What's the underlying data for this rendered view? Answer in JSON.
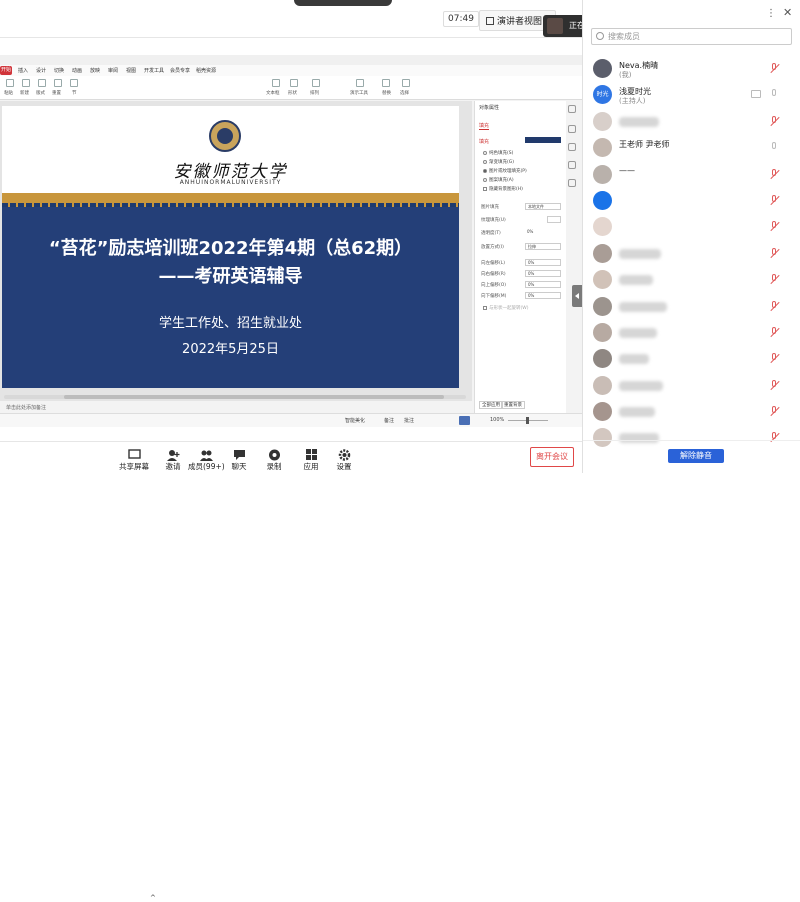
{
  "topbar": {
    "time": "07:49",
    "presenter_view": "演讲者视图",
    "speaking_label": "正在讲话:"
  },
  "participants_panel": {
    "search_placeholder": "搜索成员",
    "unmute_all": "解除静音",
    "members": [
      {
        "name": "Neva.楠晴",
        "sub": "(我)",
        "avatar_color": "#5b5e6b",
        "blur_width": 0,
        "mic": "muted"
      },
      {
        "name": "浅夏时光",
        "sub": "(主持人)",
        "avatar_color": "#2f76e4",
        "avatar_text": "时光",
        "blur_width": 0,
        "mic": "on",
        "camera": true
      },
      {
        "name": "",
        "sub": "",
        "avatar_color": "#d8cfca",
        "blur_width": 40,
        "mic": "muted"
      },
      {
        "name": "王老师 尹老师",
        "sub": "",
        "avatar_color": "#c4b8b0",
        "blur_width": 0,
        "mic": "on"
      },
      {
        "name": "——",
        "sub": "",
        "avatar_color": "#b9b1ab",
        "blur_width": 0,
        "mic": "muted"
      },
      {
        "name": "",
        "sub": "",
        "avatar_color": "#1a73e8",
        "blur_width": 0,
        "mic": "muted"
      },
      {
        "name": "",
        "sub": "",
        "avatar_color": "#e4d6cf",
        "blur_width": 0,
        "mic": "muted"
      },
      {
        "name": "",
        "sub": "",
        "avatar_color": "#a99d96",
        "blur_width": 42,
        "mic": "muted"
      },
      {
        "name": "",
        "sub": "",
        "avatar_color": "#d1c2b8",
        "blur_width": 34,
        "mic": "muted"
      },
      {
        "name": "",
        "sub": "",
        "avatar_color": "#9c948e",
        "blur_width": 48,
        "mic": "muted"
      },
      {
        "name": "",
        "sub": "",
        "avatar_color": "#b7aaa2",
        "blur_width": 38,
        "mic": "muted"
      },
      {
        "name": "",
        "sub": "",
        "avatar_color": "#8f8782",
        "blur_width": 30,
        "mic": "muted"
      },
      {
        "name": "",
        "sub": "",
        "avatar_color": "#c9bdb6",
        "blur_width": 44,
        "mic": "muted"
      },
      {
        "name": "",
        "sub": "",
        "avatar_color": "#a5958e",
        "blur_width": 36,
        "mic": "muted"
      },
      {
        "name": "",
        "sub": "",
        "avatar_color": "#d3c7c0",
        "blur_width": 40,
        "mic": "muted"
      }
    ]
  },
  "slide": {
    "university_cn": "安徽师范大学",
    "university_en": "ANHUINORMALUNIVERSITY",
    "title_line1": "“苔花”励志培训班2022年第4期（总62期）",
    "title_line2": "——考研英语辅导",
    "organizer": "学生工作处、招生就业处",
    "date": "2022年5月25日"
  },
  "wps": {
    "start_label": "开始",
    "menu": [
      "插入",
      "设计",
      "切换",
      "动画",
      "放映",
      "审阅",
      "视图",
      "开发工具",
      "会员专享",
      "稻壳资源"
    ],
    "ribbon": [
      "粘贴",
      "新建",
      "版式",
      "重置",
      "节",
      "文本框",
      "形状",
      "排列",
      "演示工具",
      "替换",
      "选择"
    ],
    "note_hint": "单击此处添加备注",
    "pane_title": "对象属性",
    "pane_tab": "填充",
    "pane_section": "填充",
    "fill_options": [
      "纯色填充(S)",
      "渐变填充(G)",
      "图片或纹理填充(P)",
      "图案填充(A)",
      "隐藏背景图形(H)"
    ],
    "fields": [
      {
        "label": "图片填充",
        "value": "本地文件"
      },
      {
        "label": "纹理填充(U)",
        "value": ""
      },
      {
        "label": "透明度(T)",
        "value": "0%"
      },
      {
        "label": "放置方式(I)",
        "value": "拉伸"
      },
      {
        "label": "向左偏移(L)",
        "value": "0%"
      },
      {
        "label": "向右偏移(R)",
        "value": "0%"
      },
      {
        "label": "向上偏移(O)",
        "value": "0%"
      },
      {
        "label": "向下偏移(M)",
        "value": "0%"
      }
    ],
    "rotate_with_shape": "与形状一起旋转(W)",
    "apply_all": "全部应用",
    "reset_bg": "重置背景",
    "status": {
      "smart_beautify": "智能美化",
      "notes": "备注",
      "comments": "批注",
      "zoom": "100%"
    }
  },
  "toolbar": {
    "items": [
      "共享屏幕",
      "邀请",
      "成员(99+)",
      "聊天",
      "录制",
      "应用",
      "设置"
    ],
    "leave": "离开会议"
  }
}
